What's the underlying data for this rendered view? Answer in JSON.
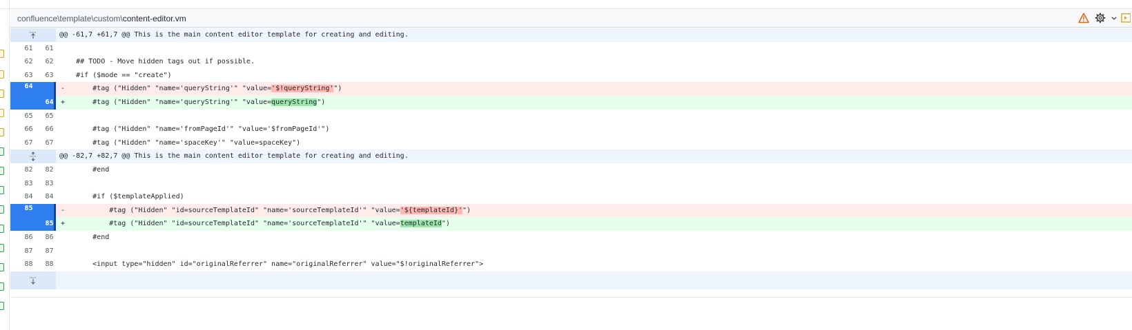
{
  "file": {
    "path_prefix": "confluence\\template\\custom\\",
    "name": "content-editor.vm"
  },
  "header_icons": [
    "warning-icon",
    "gear-icon",
    "chevron-down-icon",
    "open-file-icon"
  ],
  "colors": {
    "warning": "#e36209",
    "selection": "#2f7ff0",
    "deletion": "#ffebe9",
    "addition": "#e6ffec",
    "hunk": "#eef5fd"
  },
  "diff": {
    "hunk1": "@@ -61,7 +61,7 @@ This is the main content editor template for creating and editing.",
    "hunk2": "@@ -82,7 +82,7 @@ This is the main content editor template for creating and editing.",
    "rows": [
      {
        "old": "61",
        "new": "61",
        "text": ""
      },
      {
        "old": "62",
        "new": "62",
        "text": "    ## TODO - Move hidden tags out if possible."
      },
      {
        "old": "63",
        "new": "63",
        "text": "    #if ($mode == \"create\")"
      },
      {
        "old": "64",
        "new": "",
        "pre": "        #tag (\"Hidden\" \"name='queryString'\" \"value=",
        "hl": "'$!queryString'",
        "post": "\")"
      },
      {
        "old": "",
        "new": "64",
        "pre": "        #tag (\"Hidden\" \"name='queryString'\" \"value=",
        "hl": "queryString",
        "post": "\")"
      },
      {
        "old": "65",
        "new": "65",
        "text": ""
      },
      {
        "old": "66",
        "new": "66",
        "text": "        #tag (\"Hidden\" \"name='fromPageId'\" \"value='$fromPageId'\")"
      },
      {
        "old": "67",
        "new": "67",
        "text": "        #tag (\"Hidden\" \"name='spaceKey'\" \"value=spaceKey\")"
      },
      {
        "old": "82",
        "new": "82",
        "text": "        #end"
      },
      {
        "old": "83",
        "new": "83",
        "text": ""
      },
      {
        "old": "84",
        "new": "84",
        "text": "        #if ($templateApplied)"
      },
      {
        "old": "85",
        "new": "",
        "pre": "            #tag (\"Hidden\" \"id=sourceTemplateId\" \"name='sourceTemplateId'\" \"value=",
        "hl": "'${templateId}'",
        "post": "\")"
      },
      {
        "old": "",
        "new": "85",
        "pre": "            #tag (\"Hidden\" \"id=sourceTemplateId\" \"name='sourceTemplateId'\" \"value=",
        "hl": "templateId",
        "post": "\")"
      },
      {
        "old": "86",
        "new": "86",
        "text": "        #end"
      },
      {
        "old": "87",
        "new": "87",
        "text": ""
      },
      {
        "old": "88",
        "new": "88",
        "text": "        <input type=\"hidden\" id=\"originalReferrer\" name=\"originalReferrer\" value=\"$!originalReferrer\">"
      }
    ],
    "minus": "-",
    "plus": "+"
  }
}
